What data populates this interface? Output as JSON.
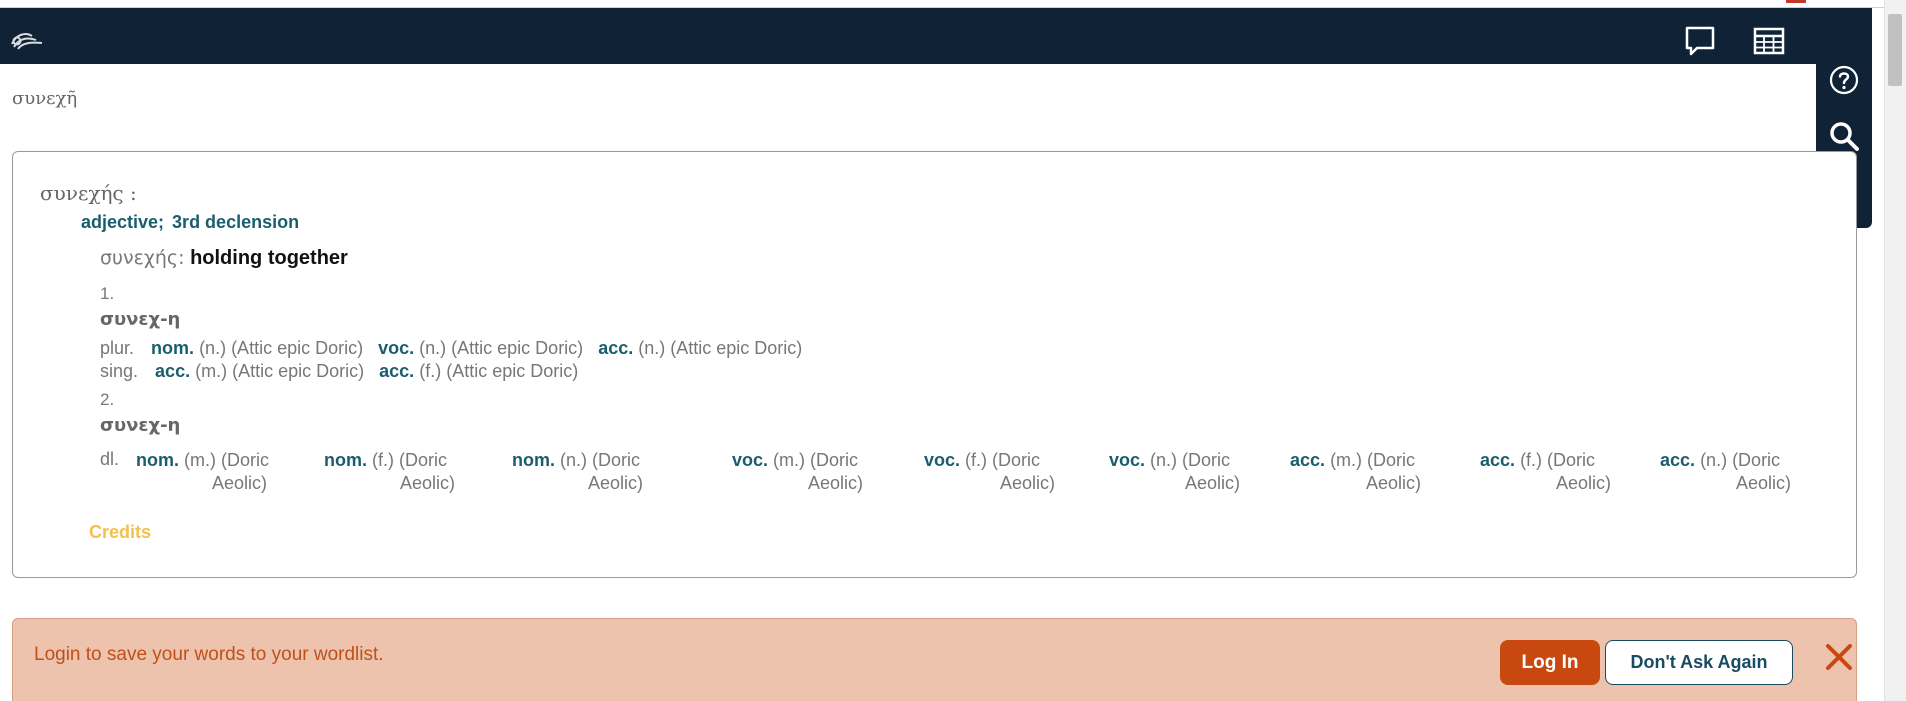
{
  "app": {
    "icon": "perseus-logo-icon"
  },
  "navbar": {
    "icons": [
      "comment-icon",
      "table-icon"
    ]
  },
  "side_panel": {
    "icons": [
      "help-icon",
      "search-icon",
      "dictionary-icon",
      "chevron-down-icon"
    ]
  },
  "query": "συνεχῆ",
  "entry": {
    "lemma": "συνεχής :",
    "pos": [
      "adjective;",
      "3rd declension"
    ],
    "gloss_greek": "συνεχής:",
    "gloss_english": "holding together",
    "groups": [
      {
        "number": "1.",
        "stem": "συνεχ-η",
        "rows": [
          {
            "label": "plur.",
            "items": [
              {
                "case": "nom.",
                "form": "(n.) (Attic epic Doric)"
              },
              {
                "case": "voc.",
                "form": "(n.) (Attic epic Doric)"
              },
              {
                "case": "acc.",
                "form": "(n.) (Attic epic Doric)"
              }
            ]
          },
          {
            "label": "sing.",
            "items": [
              {
                "case": "acc.",
                "form": "(m.) (Attic epic Doric)"
              },
              {
                "case": "acc.",
                "form": "(f.) (Attic epic Doric)"
              }
            ]
          }
        ]
      },
      {
        "number": "2.",
        "stem": "συνεχ-η",
        "dual": {
          "label": "dl.",
          "items": [
            {
              "case": "nom.",
              "form": "(m.) (Doric",
              "form2": "Aeolic)"
            },
            {
              "case": "nom.",
              "form": "(f.) (Doric",
              "form2": "Aeolic)"
            },
            {
              "case": "nom.",
              "form": "(n.) (Doric",
              "form2": "Aeolic)"
            },
            {
              "case": "voc.",
              "form": "(m.) (Doric",
              "form2": "Aeolic)"
            },
            {
              "case": "voc.",
              "form": "(f.) (Doric",
              "form2": "Aeolic)"
            },
            {
              "case": "voc.",
              "form": "(n.) (Doric",
              "form2": "Aeolic)"
            },
            {
              "case": "acc.",
              "form": "(m.) (Doric",
              "form2": "Aeolic)"
            },
            {
              "case": "acc.",
              "form": "(f.) (Doric",
              "form2": "Aeolic)"
            },
            {
              "case": "acc.",
              "form": "(n.) (Doric",
              "form2": "Aeolic)"
            }
          ]
        }
      }
    ],
    "credits": "Credits"
  },
  "banner": {
    "message": "Login to save your words to your wordlist.",
    "login_label": "Log In",
    "dont_ask_label": "Don't Ask Again",
    "close_icon": "close-icon"
  },
  "colors": {
    "navbar": "#0f2236",
    "accent_teal": "#1a5e6e",
    "credits": "#f3c04c",
    "banner_bg": "#edc3ae",
    "banner_text": "#c0501b",
    "login_button": "#c9480f"
  }
}
